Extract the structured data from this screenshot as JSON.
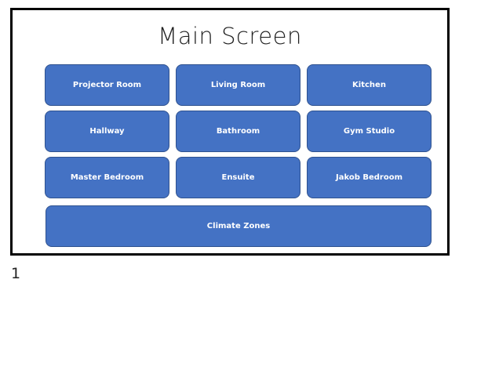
{
  "screen": {
    "title": "Main Screen",
    "page_number": "1"
  },
  "buttons": [
    {
      "label": "Projector Room"
    },
    {
      "label": "Living Room"
    },
    {
      "label": "Kitchen"
    },
    {
      "label": "Hallway"
    },
    {
      "label": "Bathroom"
    },
    {
      "label": "Gym Studio"
    },
    {
      "label": "Master Bedroom"
    },
    {
      "label": "Ensuite"
    },
    {
      "label": "Jakob Bedroom"
    },
    {
      "label": "Climate Zones"
    }
  ],
  "colors": {
    "button_fill": "#4472c4",
    "button_border": "#2f528f",
    "frame_border": "#000000"
  }
}
